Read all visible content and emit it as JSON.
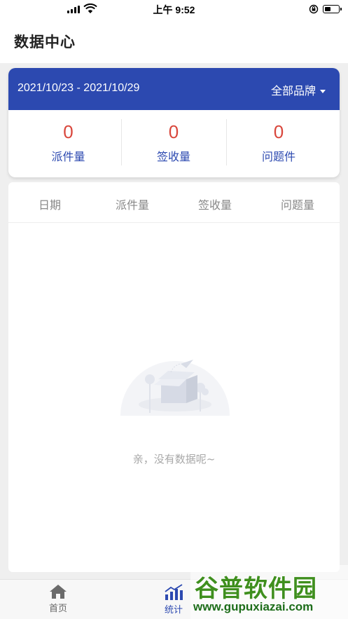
{
  "status_bar": {
    "time": "上午 9:52",
    "icons": [
      "cellular-signal-icon",
      "wifi-icon",
      "orientation-lock-icon",
      "battery-icon"
    ]
  },
  "header": {
    "title": "数据中心"
  },
  "summary": {
    "date_range": "2021/10/23 - 2021/10/29",
    "brand_filter": "全部品牌",
    "stats": [
      {
        "value": "0",
        "label": "派件量"
      },
      {
        "value": "0",
        "label": "签收量"
      },
      {
        "value": "0",
        "label": "问题件"
      }
    ]
  },
  "table": {
    "columns": [
      "日期",
      "派件量",
      "签收量",
      "问题量"
    ],
    "rows": [],
    "empty_message": "亲，没有数据呢~"
  },
  "tab_bar": {
    "tabs": [
      {
        "label": "首页",
        "icon": "home-icon",
        "active": false
      },
      {
        "label": "统计",
        "icon": "bar-chart-icon",
        "active": true
      }
    ]
  },
  "watermark": {
    "text": "谷普软件园",
    "url": "www.gupuxiazai.com"
  },
  "colors": {
    "primary": "#2c49b0",
    "stat_value": "#d9473c",
    "page_background": "#efefef",
    "watermark": "#3f8f1e"
  }
}
